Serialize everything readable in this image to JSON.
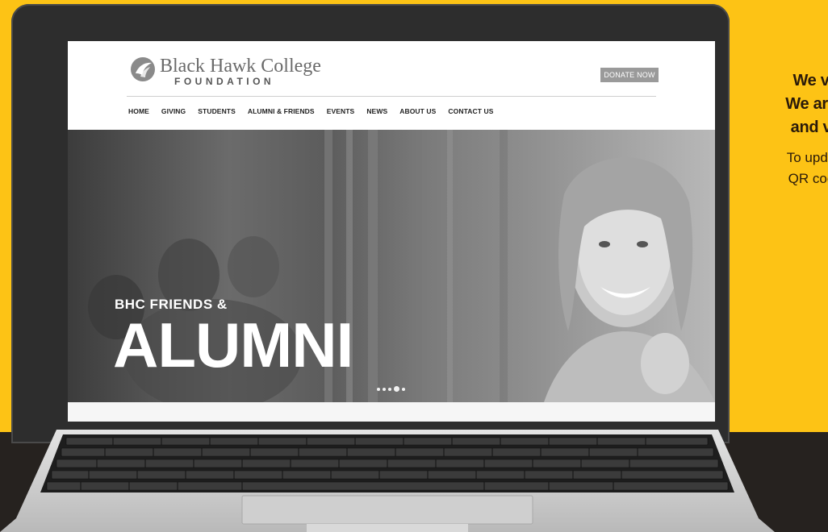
{
  "promo": {
    "line1": "We v",
    "line2": "We are",
    "line3": "and v",
    "line4": "To upda",
    "line5": "QR coc"
  },
  "site": {
    "logo_name": "Black Hawk College",
    "logo_sub": "FOUNDATION",
    "donate_label": "DONATE NOW",
    "nav": [
      "HOME",
      "GIVING",
      "STUDENTS",
      "ALUMNI & FRIENDS",
      "EVENTS",
      "NEWS",
      "ABOUT US",
      "CONTACT US"
    ]
  },
  "hero": {
    "subtitle": "BHC FRIENDS &",
    "title": "ALUMNI",
    "slide_count": 5,
    "active_slide": 4
  },
  "colors": {
    "background": "#fdc315",
    "dark_band": "#26221f",
    "laptop_bezel": "#2d2d2d",
    "donate_button": "#9a9a9a"
  }
}
